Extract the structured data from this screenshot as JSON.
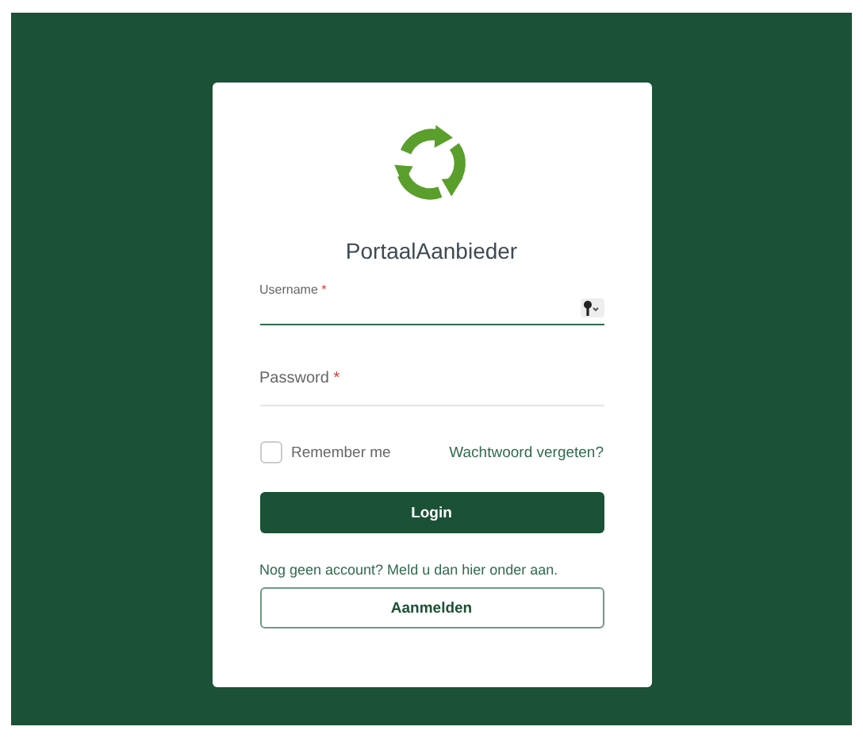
{
  "title": "PortaalAanbieder",
  "fields": [
    {
      "label": "Username",
      "required_mark": "*",
      "focused": true,
      "floating": true,
      "kind": "keyed"
    },
    {
      "label": "Password",
      "required_mark": "*",
      "focused": false,
      "floating": false,
      "kind": "plain"
    }
  ],
  "remember": {
    "label": "Remember me",
    "checked": false
  },
  "forgot_link": "Wachtwoord vergeten?",
  "login_button": "Login",
  "signup_text": "Nog geen account? Meld u dan hier onder aan.",
  "signup_button": "Aanmelden"
}
